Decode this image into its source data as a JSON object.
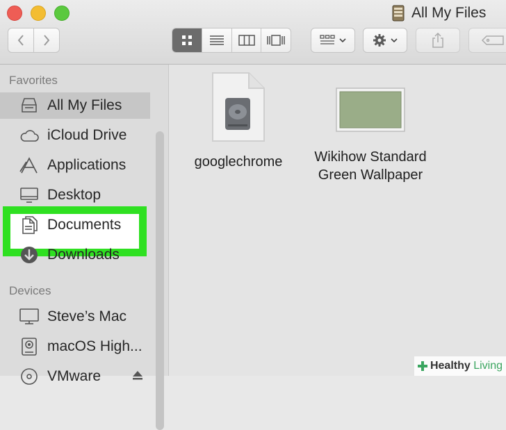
{
  "window": {
    "title": "All My Files"
  },
  "sidebar": {
    "favorites_label": "Favorites",
    "devices_label": "Devices",
    "favorites": [
      {
        "label": "All My Files",
        "icon": "all-my-files-icon",
        "selected": true
      },
      {
        "label": "iCloud Drive",
        "icon": "cloud-icon"
      },
      {
        "label": "Applications",
        "icon": "applications-icon"
      },
      {
        "label": "Desktop",
        "icon": "desktop-icon"
      },
      {
        "label": "Documents",
        "icon": "documents-icon"
      },
      {
        "label": "Downloads",
        "icon": "downloads-icon"
      }
    ],
    "devices": [
      {
        "label": "Steve’s Mac",
        "icon": "computer-icon"
      },
      {
        "label": "macOS High...",
        "icon": "hard-disk-icon"
      },
      {
        "label": "VMware",
        "icon": "disk-icon"
      }
    ]
  },
  "files": [
    {
      "name": "googlechrome",
      "icon": "disk-image-icon"
    },
    {
      "name_line1": "Wikihow Standard",
      "name_line2": "Green Wallpaper",
      "icon": "image-thumbnail-icon"
    }
  ],
  "watermark": {
    "part1": "Healthy",
    "part2": "Living"
  },
  "colors": {
    "highlight": "#2fe021",
    "wallpaper": "#9aad88"
  }
}
